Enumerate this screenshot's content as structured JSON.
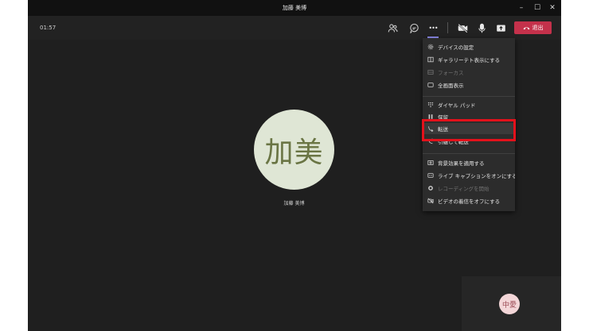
{
  "window": {
    "title": "加藤 美博",
    "controls": [
      "–",
      "☐",
      "✕"
    ]
  },
  "toolbar": {
    "timer": "01:57",
    "more_label": "•••",
    "leave_label": "退出"
  },
  "stage": {
    "participant_initials": "加美",
    "participant_name": "加藤 美博"
  },
  "self_view": {
    "initials": "中愛"
  },
  "more_menu": {
    "items": [
      {
        "label": "デバイスの設定",
        "icon": "gear-icon"
      },
      {
        "label": "ギャラリーテト表示にする",
        "icon": "gallery-icon"
      },
      {
        "label": "フォーカス",
        "icon": "focus-icon"
      },
      {
        "label": "全画面表示",
        "icon": "fullscreen-icon"
      },
      {
        "label": "ダイヤル パッド",
        "icon": "dialpad-icon"
      },
      {
        "label": "保留",
        "icon": "hold-icon"
      },
      {
        "label": "転送",
        "icon": "transfer-icon"
      },
      {
        "label": "引継して転送",
        "icon": "consult-transfer-icon"
      },
      {
        "label": "背景効果を適用する",
        "icon": "background-icon"
      },
      {
        "label": "ライブ キャプションをオンにする",
        "icon": "captions-icon"
      },
      {
        "label": "レコーディングを開始",
        "icon": "record-icon"
      },
      {
        "label": "ビデオの着信をオフにする",
        "icon": "video-off-icon"
      }
    ]
  },
  "colors": {
    "accent": "#8c8ae8",
    "leave": "#c4314b",
    "highlight_box": "#e3111b"
  }
}
